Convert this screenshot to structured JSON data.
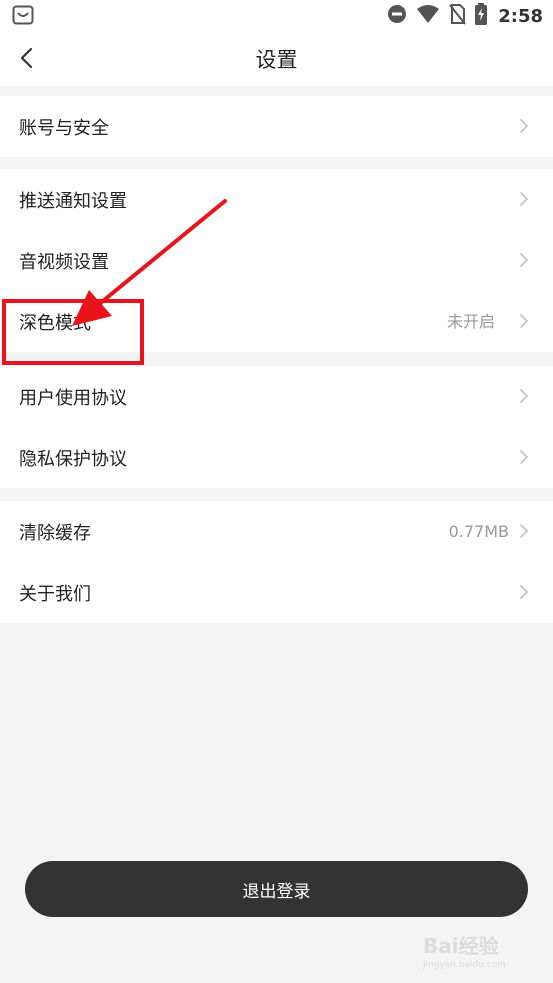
{
  "status_bar": {
    "time": "2:58"
  },
  "header": {
    "title": "设置"
  },
  "groups": [
    {
      "items": [
        {
          "label": "账号与安全",
          "value": ""
        }
      ]
    },
    {
      "items": [
        {
          "label": "推送通知设置",
          "value": ""
        },
        {
          "label": "音视频设置",
          "value": ""
        },
        {
          "label": "深色模式",
          "value": "未开启"
        }
      ]
    },
    {
      "items": [
        {
          "label": "用户使用协议",
          "value": ""
        },
        {
          "label": "隐私保护协议",
          "value": ""
        }
      ]
    },
    {
      "items": [
        {
          "label": "清除缓存",
          "value": "0.77MB"
        },
        {
          "label": "关于我们",
          "value": ""
        }
      ]
    }
  ],
  "logout": {
    "label": "退出登录"
  },
  "watermark": {
    "text": "Bai经验",
    "sub": "jingyan.baidu.com"
  },
  "colors": {
    "annotation": "#e8131b",
    "logout_bg": "#333333",
    "page_bg": "#f4f4f4"
  }
}
